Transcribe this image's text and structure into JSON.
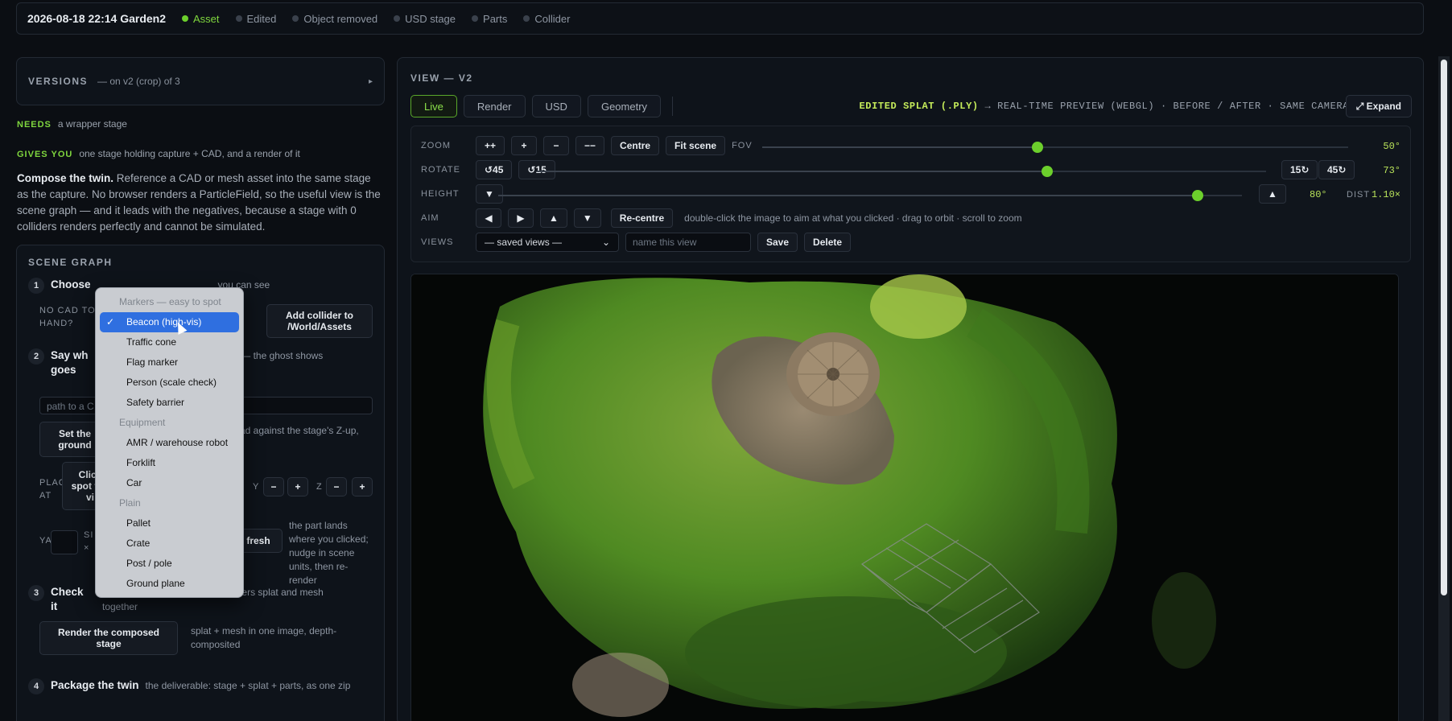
{
  "topbar": {
    "title": "2026-08-18 22:14 Garden2",
    "stages": [
      {
        "label": "Asset",
        "active": true
      },
      {
        "label": "Edited",
        "active": false
      },
      {
        "label": "Object removed",
        "active": false
      },
      {
        "label": "USD stage",
        "active": false
      },
      {
        "label": "Parts",
        "active": false
      },
      {
        "label": "Collider",
        "active": false
      }
    ]
  },
  "versions": {
    "title": "VERSIONS",
    "sub": "— on v2 (crop) of 3",
    "arrow": "▸"
  },
  "needs": {
    "key": "NEEDS",
    "text": "a wrapper stage"
  },
  "gives": {
    "key": "GIVES YOU",
    "text": "one stage holding capture + CAD, and a render of it"
  },
  "compose": {
    "bold": "Compose the twin.",
    "text": " Reference a CAD or mesh asset into the same stage as the capture. No browser renders a ParticleField, so the useful view is the scene graph — and it leads with the negatives, because a stage with 0 colliders renders perfectly and cannot be simulated."
  },
  "scene_graph": {
    "title": "SCENE GRAPH",
    "step1": {
      "num": "1",
      "label": "Choose",
      "desc_tail": "you can see",
      "no_cad_label": "NO CAD TO HAND?",
      "hidden_btn": "e",
      "add_collider_btn": "Add collider to /World/Assets"
    },
    "step2": {
      "num": "2",
      "label": "Say wh",
      "label2": "goes",
      "desc_tail": "nudge — the ghost shows",
      "path_placeholder": "path to a C",
      "set_ground_btn": "Set the ground",
      "ground_desc_tail": "ad against the stage's Z-up,",
      "place_label": "PLACE AT",
      "click_spot_btn": "Click spot the vi",
      "axis_y": "Y",
      "axis_z": "Z",
      "minus": "−",
      "plus": "+",
      "yaw_label": "YA",
      "size_label": "SI ×",
      "refresh_btn": "fresh",
      "lands_desc": "the part lands where you clicked; nudge in scene units, then re-render"
    },
    "step3": {
      "num": "3",
      "label": "Check it",
      "desc": "the wireframes are live; this renders splat and mesh together",
      "btn": "Render the composed stage",
      "btn_desc": "splat + mesh in one image, depth-composited"
    },
    "step4": {
      "num": "4",
      "label": "Package the twin",
      "desc": "the deliverable: stage + splat + parts, as one zip"
    }
  },
  "menu": {
    "groups": [
      {
        "label": "Markers — easy to spot",
        "options": [
          {
            "label": "Beacon (high-vis)",
            "selected": true
          },
          {
            "label": "Traffic cone"
          },
          {
            "label": "Flag marker"
          },
          {
            "label": "Person (scale check)"
          },
          {
            "label": "Safety barrier"
          }
        ]
      },
      {
        "label": "Equipment",
        "options": [
          {
            "label": "AMR / warehouse robot"
          },
          {
            "label": "Forklift"
          },
          {
            "label": "Car"
          }
        ]
      },
      {
        "label": "Plain",
        "options": [
          {
            "label": "Pallet"
          },
          {
            "label": "Crate"
          },
          {
            "label": "Post / pole"
          },
          {
            "label": "Ground plane"
          }
        ]
      }
    ],
    "check": "✓"
  },
  "view": {
    "title": "VIEW — V2",
    "tabs": [
      {
        "label": "Live",
        "active": true
      },
      {
        "label": "Render"
      },
      {
        "label": "USD"
      },
      {
        "label": "Geometry"
      }
    ],
    "edited_bold": "EDITED SPLAT (.PLY)",
    "edited_rest": " → REAL-TIME PREVIEW (WEBGL) · BEFORE / AFTER · SAME CAMERA",
    "expand": "⤢ Expand"
  },
  "controls": {
    "zoom": {
      "label": "ZOOM",
      "buttons": [
        "++",
        "+",
        "−",
        "−−",
        "Centre",
        "Fit scene"
      ],
      "fov_label": "FOV",
      "fov_value": "50°",
      "fov_fraction": 0.47
    },
    "rotate": {
      "label": "ROTATE",
      "buttons": [
        "↺45",
        "↺15"
      ],
      "right_buttons": [
        "15↻",
        "45↻"
      ],
      "value": "73°",
      "fraction": 0.7
    },
    "height": {
      "label": "HEIGHT",
      "down": "▼",
      "up": "▲",
      "value": "80°",
      "dist_label": "DIST",
      "dist_value": "1.10×",
      "fraction": 0.94
    },
    "aim": {
      "label": "AIM",
      "buttons": [
        "◀",
        "▶",
        "▲",
        "▼"
      ],
      "recentre": "Re-centre",
      "hint": "double-click the image to aim at what you clicked · drag to orbit · scroll to zoom"
    },
    "views": {
      "label": "VIEWS",
      "select_value": "— saved views —",
      "name_placeholder": "name this view",
      "save": "Save",
      "delete": "Delete"
    }
  },
  "colors": {
    "accent": "#6ccf2c",
    "bg": "#0b0e13",
    "panel": "#0e131a",
    "selected": "#2f6fe0"
  }
}
